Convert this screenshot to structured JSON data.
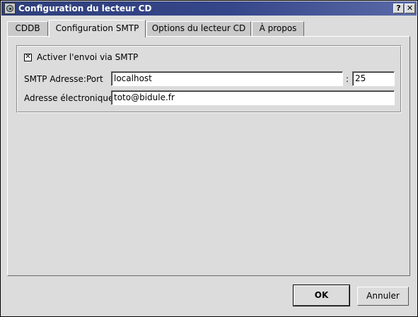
{
  "window": {
    "title": "Configuration du lecteur CD",
    "help_button": "?",
    "close_button": "✕"
  },
  "tabs": [
    {
      "label": "CDDB",
      "active": false
    },
    {
      "label": "Configuration SMTP",
      "active": true
    },
    {
      "label": "Options du lecteur CD",
      "active": false
    },
    {
      "label": "À propos",
      "active": false
    }
  ],
  "smtp": {
    "enable_checkbox": {
      "checked": true,
      "label": "Activer l'envoi via SMTP",
      "mark": "✕"
    },
    "address_label": "SMTP Adresse:Port",
    "host_value": "localhost",
    "separator": ":",
    "port_value": "25",
    "email_label": "Adresse électronique",
    "email_value": "toto@bidule.fr"
  },
  "buttons": {
    "ok": "OK",
    "cancel": "Annuler"
  },
  "colors": {
    "titlebar": "#35468a",
    "window_bg": "#dcdcdc",
    "field_bg": "#ffffff"
  }
}
